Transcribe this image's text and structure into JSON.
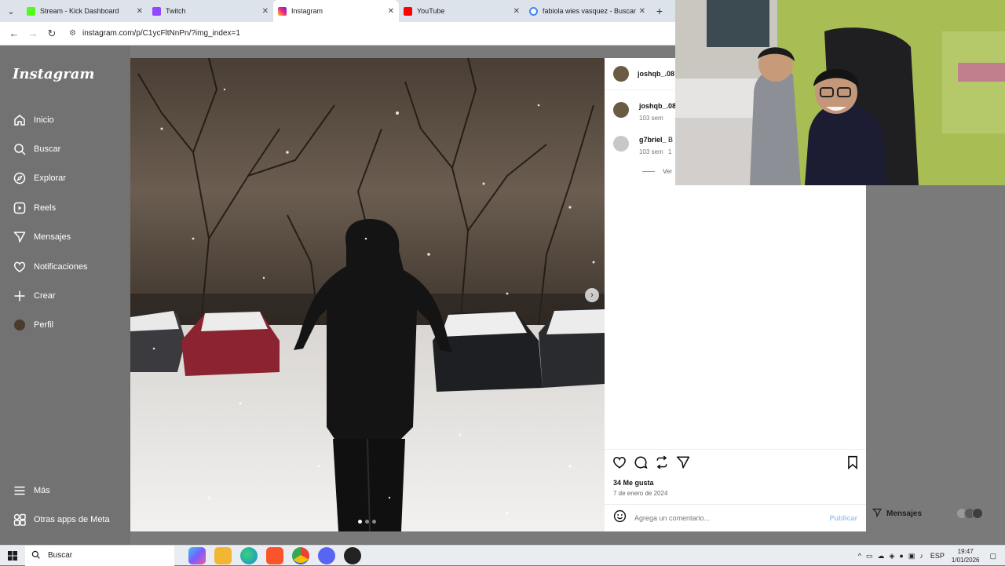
{
  "browser": {
    "tabs": [
      {
        "label": "Stream - Kick Dashboard",
        "favicon_color": "#53fc18",
        "active": false
      },
      {
        "label": "Twitch",
        "favicon_color": "#9146ff",
        "active": false
      },
      {
        "label": "Instagram",
        "favicon_color": "#e1306c",
        "active": true
      },
      {
        "label": "YouTube",
        "favicon_color": "#ff0000",
        "active": false
      },
      {
        "label": "fabiola wies vasquez - Buscar c",
        "favicon_color": "#4285f4",
        "active": false
      }
    ],
    "url": "instagram.com/p/C1ycFltNnPn/?img_index=1"
  },
  "instagram": {
    "logo": "Instagram",
    "nav": [
      {
        "label": "Inicio",
        "icon": "home-icon"
      },
      {
        "label": "Buscar",
        "icon": "search-icon"
      },
      {
        "label": "Explorar",
        "icon": "compass-icon"
      },
      {
        "label": "Reels",
        "icon": "reels-icon"
      },
      {
        "label": "Mensajes",
        "icon": "messenger-icon"
      },
      {
        "label": "Notificaciones",
        "icon": "heart-icon"
      },
      {
        "label": "Crear",
        "icon": "plus-icon"
      },
      {
        "label": "Perfil",
        "icon": "profile-avatar"
      }
    ],
    "bottom_nav": [
      {
        "label": "Más",
        "icon": "menu-icon"
      },
      {
        "label": "Otras apps de Meta",
        "icon": "meta-apps-icon"
      }
    ],
    "post": {
      "author": "joshqb_.08",
      "comments": [
        {
          "user": "joshqb_.08",
          "time": "103 sem",
          "extra": ""
        },
        {
          "user": "g7briel_",
          "text": "B",
          "time": "103 sem",
          "extra": "1"
        }
      ],
      "view_replies": "Ver",
      "likes": "34 Me gusta",
      "date": "7 de enero de 2024",
      "comment_placeholder": "Agrega un comentario...",
      "publish_label": "Publicar",
      "carousel_slides": 3,
      "carousel_current": 1
    },
    "messages_pill": "Mensajes"
  },
  "taskbar": {
    "search_label": "Buscar",
    "apps": [
      {
        "icon": "copilot-icon",
        "color": "#7a5cff"
      },
      {
        "icon": "file-explorer-icon",
        "color": "#f2b632"
      },
      {
        "icon": "edge-icon",
        "color": "#1b8fd1"
      },
      {
        "icon": "brave-icon",
        "color": "#fb542b"
      },
      {
        "icon": "chrome-icon",
        "color": "#34a853"
      },
      {
        "icon": "discord-icon",
        "color": "#5865f2"
      },
      {
        "icon": "recording-app-icon",
        "color": "#222222"
      }
    ],
    "language": "ESP",
    "time": "19:47",
    "date": "1/01/2026"
  }
}
